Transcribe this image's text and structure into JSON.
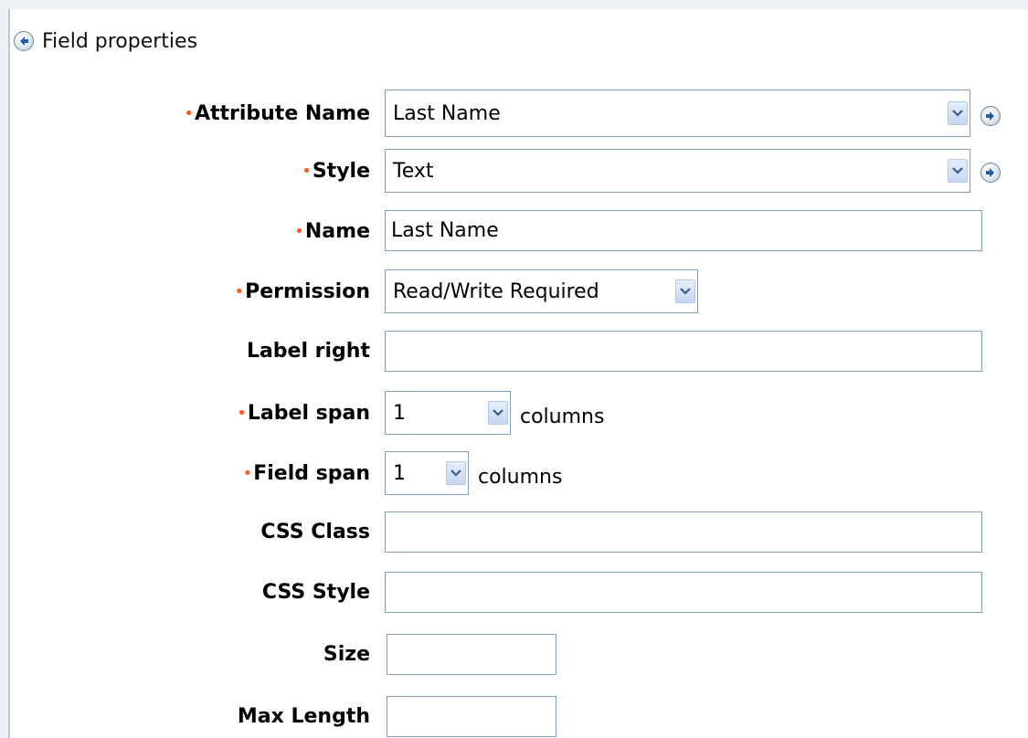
{
  "header": {
    "title": "Field properties",
    "back_icon": "back-arrow-icon"
  },
  "fields": {
    "attribute_name": {
      "label": "Attribute Name",
      "required": true,
      "value": "Last Name"
    },
    "style": {
      "label": "Style",
      "required": true,
      "value": "Text"
    },
    "name": {
      "label": "Name",
      "required": true,
      "value": "Last Name"
    },
    "permission": {
      "label": "Permission",
      "required": true,
      "value": "Read/Write Required"
    },
    "label_right": {
      "label": "Label right",
      "required": false,
      "value": ""
    },
    "label_span": {
      "label": "Label span",
      "required": true,
      "value": "1",
      "suffix": "columns"
    },
    "field_span": {
      "label": "Field span",
      "required": true,
      "value": "1",
      "suffix": "columns"
    },
    "css_class": {
      "label": "CSS Class",
      "required": false,
      "value": ""
    },
    "css_style": {
      "label": "CSS Style",
      "required": false,
      "value": ""
    },
    "size": {
      "label": "Size",
      "required": false,
      "value": ""
    },
    "max_length": {
      "label": "Max Length",
      "required": false,
      "value": ""
    }
  },
  "required_marker": "•",
  "colors": {
    "required": "#ff5a1f",
    "border": "#7f9db9",
    "strip": "#eef1f4"
  }
}
